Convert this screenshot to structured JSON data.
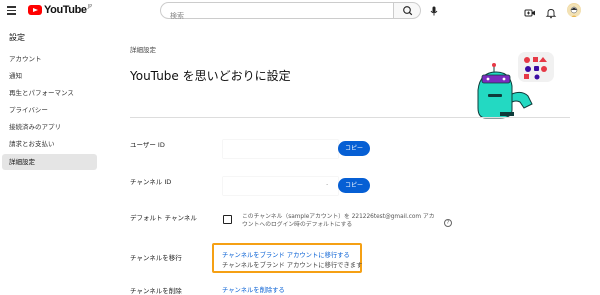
{
  "header": {
    "logo_text": "YouTube",
    "logo_sup": "JP",
    "search_placeholder": "検索"
  },
  "sidebar": {
    "title": "設定",
    "items": [
      {
        "label": "アカウント"
      },
      {
        "label": "通知"
      },
      {
        "label": "再生とパフォーマンス"
      },
      {
        "label": "プライバシー"
      },
      {
        "label": "接続済みのアプリ"
      },
      {
        "label": "請求とお支払い"
      },
      {
        "label": "詳細設定"
      }
    ]
  },
  "main": {
    "section_label": "詳細設定",
    "title": "YouTube を思いどおりに設定",
    "user_id": {
      "label": "ユーザー ID",
      "value": "",
      "copy_label": "コピー"
    },
    "channel_id": {
      "label": "チャンネル ID",
      "value": "·",
      "copy_label": "コピー"
    },
    "default_channel": {
      "label": "デフォルト チャンネル",
      "description": "このチャンネル（sampleアカウント）を 221226test@gmail.com アカウントへのログイン時のデフォルトにする",
      "help_icon": "?"
    },
    "move_channel": {
      "label": "チャンネルを移行",
      "link": "チャンネルをブランド アカウントに移行する",
      "subtext": "チャンネルをブランド アカウントに移行できます"
    },
    "delete_channel": {
      "label": "チャンネルを削除",
      "link": "チャンネルを削除する"
    }
  },
  "colors": {
    "accent": "#065fd4",
    "highlight": "#f5a014",
    "brand": "#ff0000"
  }
}
